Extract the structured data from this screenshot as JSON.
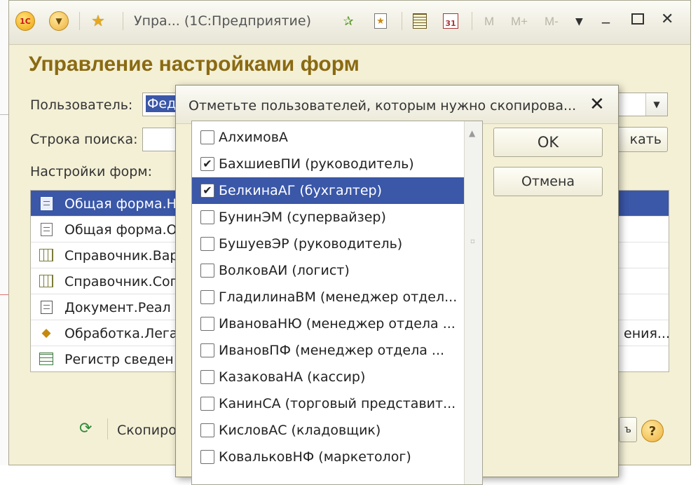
{
  "window": {
    "title": "Упра...   (1С:Предприятие)",
    "toolbar": {
      "m": "M",
      "m_plus": "M+",
      "m_minus": "M-"
    }
  },
  "form": {
    "title": "Управление настройками форм",
    "user_label": "Пользователь:",
    "user_value": "Фед",
    "search_label": "Строка поиска:",
    "search_button": "кать",
    "settings_label": "Настройки форм:",
    "rows": [
      {
        "icon": "form-doc-icon",
        "text": "Общая форма.Н",
        "selected": true
      },
      {
        "icon": "form-doc-icon",
        "text": "Общая форма.О",
        "selected": false
      },
      {
        "icon": "catalog-icon",
        "text": "Справочник.Вар",
        "selected": false
      },
      {
        "icon": "catalog-icon",
        "text": "Справочник.Соп",
        "selected": false
      },
      {
        "icon": "document-icon",
        "text": "Документ.Реал",
        "selected": false
      },
      {
        "icon": "processing-icon",
        "text": "Обработка.Лега",
        "right_text": "ения...",
        "selected": false
      },
      {
        "icon": "register-icon",
        "text": "Регистр сведен",
        "selected": false
      }
    ],
    "copy_button": "Скопиро"
  },
  "dialog": {
    "title": "Отметьте пользователей, которым нужно скопирова...",
    "ok_label": "OK",
    "cancel_label": "Отмена",
    "users": [
      {
        "name": "АлхимовА",
        "checked": false,
        "selected": false
      },
      {
        "name": "БахшиевПИ (руководитель)",
        "checked": true,
        "selected": false
      },
      {
        "name": "БелкинаАГ (бухгалтер)",
        "checked": true,
        "selected": true
      },
      {
        "name": "БунинЭМ (супервайзер)",
        "checked": false,
        "selected": false
      },
      {
        "name": "БушуевЭР (руководитель)",
        "checked": false,
        "selected": false
      },
      {
        "name": "ВолковАИ (логист)",
        "checked": false,
        "selected": false
      },
      {
        "name": "ГладилинаВМ (менеджер отдел...",
        "checked": false,
        "selected": false
      },
      {
        "name": "ИвановаНЮ (менеджер отдела ...",
        "checked": false,
        "selected": false
      },
      {
        "name": "ИвановПФ (менеджер отдела ...",
        "checked": false,
        "selected": false
      },
      {
        "name": "КазаковаНА (кассир)",
        "checked": false,
        "selected": false
      },
      {
        "name": "КанинСА (торговый представит...",
        "checked": false,
        "selected": false
      },
      {
        "name": "КисловАС (кладовщик)",
        "checked": false,
        "selected": false
      },
      {
        "name": "КовальковНФ (маркетолог)",
        "checked": false,
        "selected": false
      }
    ]
  }
}
